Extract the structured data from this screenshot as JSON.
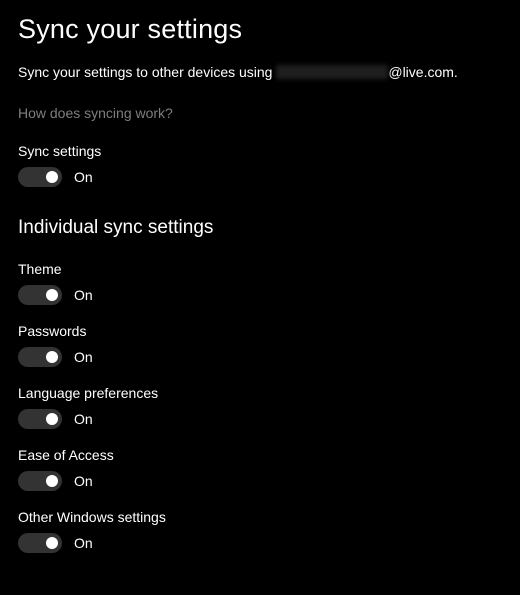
{
  "page": {
    "title": "Sync your settings",
    "desc_prefix": "Sync your settings to other devices using ",
    "desc_suffix": "@live.com.",
    "help_link": "How does syncing work?"
  },
  "sync_settings": {
    "label": "Sync settings",
    "state": "On"
  },
  "section_title": "Individual sync settings",
  "items": [
    {
      "label": "Theme",
      "state": "On"
    },
    {
      "label": "Passwords",
      "state": "On"
    },
    {
      "label": "Language preferences",
      "state": "On"
    },
    {
      "label": "Ease of Access",
      "state": "On"
    },
    {
      "label": "Other Windows settings",
      "state": "On"
    }
  ]
}
